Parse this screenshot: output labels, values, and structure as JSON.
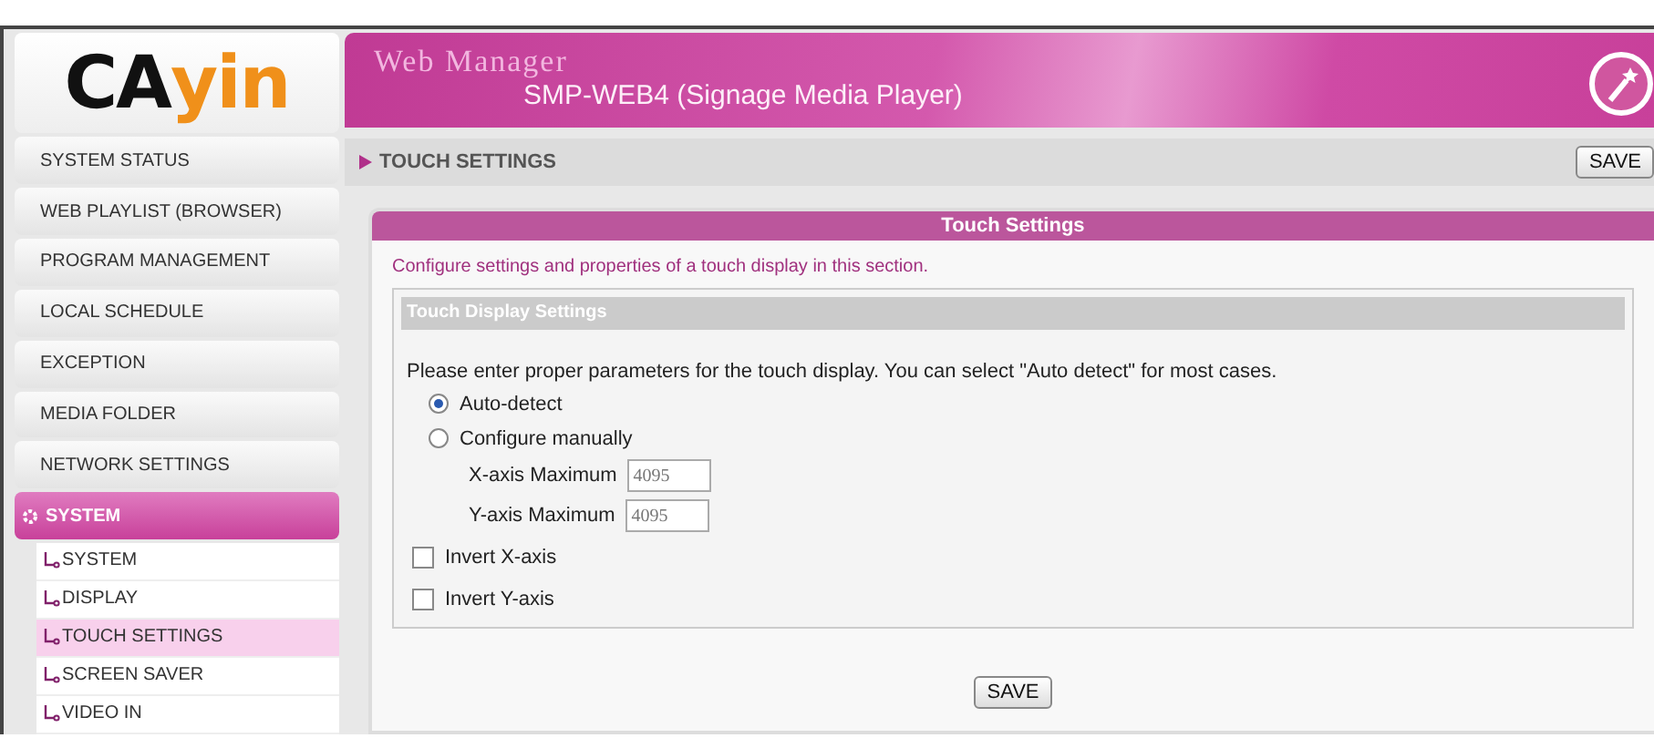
{
  "header": {
    "logo": "CAyin",
    "title": "Web Manager",
    "subtitle": "SMP-WEB4 (Signage Media Player)"
  },
  "sidebar": {
    "items": [
      {
        "label": "SYSTEM STATUS",
        "selected": false
      },
      {
        "label": "WEB PLAYLIST (BROWSER)",
        "selected": false
      },
      {
        "label": "PROGRAM MANAGEMENT",
        "selected": false
      },
      {
        "label": "LOCAL SCHEDULE",
        "selected": false
      },
      {
        "label": "EXCEPTION",
        "selected": false
      },
      {
        "label": "MEDIA FOLDER",
        "selected": false
      },
      {
        "label": "NETWORK SETTINGS",
        "selected": false
      },
      {
        "label": "SYSTEM",
        "selected": true,
        "children": [
          {
            "label": "SYSTEM",
            "selected": false
          },
          {
            "label": "DISPLAY",
            "selected": false
          },
          {
            "label": "TOUCH SETTINGS",
            "selected": true
          },
          {
            "label": "SCREEN SAVER",
            "selected": false
          },
          {
            "label": "VIDEO IN",
            "selected": false
          }
        ]
      }
    ]
  },
  "breadcrumb": {
    "label": "TOUCH SETTINGS",
    "save_button": "SAVE"
  },
  "panel": {
    "title": "Touch Settings",
    "description": "Configure settings and properties of a touch display in this section.",
    "section_title": "Touch Display Settings",
    "instructions": "Please enter proper parameters for the touch display. You can select \"Auto detect\" for most cases.",
    "radios": [
      {
        "label": "Auto-detect",
        "selected": true
      },
      {
        "label": "Configure manually",
        "selected": false
      }
    ],
    "fields": [
      {
        "label": "X-axis Maximum",
        "value": "4095"
      },
      {
        "label": "Y-axis Maximum",
        "value": "4095"
      }
    ],
    "checkboxes": [
      {
        "label": "Invert X-axis",
        "checked": false
      },
      {
        "label": "Invert Y-axis",
        "checked": false
      }
    ],
    "save_button": "SAVE"
  }
}
